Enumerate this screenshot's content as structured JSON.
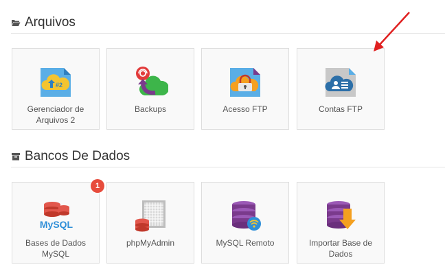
{
  "sections": [
    {
      "title": "Arquivos",
      "icon": "folder-open-icon",
      "tiles": [
        {
          "label_line1": "Gerenciador de",
          "label_line2": "Arquivos 2",
          "icon": "file-manager-icon"
        },
        {
          "label_line1": "Backups",
          "label_line2": "",
          "icon": "backup-icon"
        },
        {
          "label_line1": "Acesso FTP",
          "label_line2": "",
          "icon": "ftp-access-icon"
        },
        {
          "label_line1": "Contas FTP",
          "label_line2": "",
          "icon": "ftp-accounts-icon"
        }
      ]
    },
    {
      "title": "Bancos De Dados",
      "icon": "archive-icon",
      "tiles": [
        {
          "label_line1": "Bases de Dados",
          "label_line2": "MySQL",
          "icon": "mysql-databases-icon",
          "badge": "1"
        },
        {
          "label_line1": "phpMyAdmin",
          "label_line2": "",
          "icon": "phpmyadmin-icon"
        },
        {
          "label_line1": "MySQL Remoto",
          "label_line2": "",
          "icon": "remote-mysql-icon"
        },
        {
          "label_line1": "Importar Base de",
          "label_line2": "Dados",
          "icon": "import-database-icon"
        }
      ]
    }
  ],
  "icon_text": {
    "file_manager": "#2",
    "mysql": "MySQL"
  },
  "colors": {
    "accent_blue": "#5aaee6",
    "badge_red": "#e74c3c",
    "db_red": "#e2574c",
    "db_purple": "#7a3a8c",
    "annotation_arrow": "#e02020"
  }
}
